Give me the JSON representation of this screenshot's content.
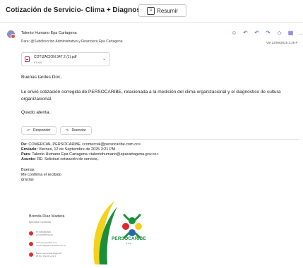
{
  "header": {
    "subject": "Cotización de Servicio- Clima + Diagnostico",
    "summarize_label": "Resumir"
  },
  "message": {
    "sender": "Talento Humano Epa Cartagena",
    "to_line": "Para: @Subdireccion Administrativa y Financiera Epa Cartagena",
    "date": "Vie 12/09/2025 3:26 P",
    "attachment": {
      "name": "COTIZACION 347 2 (1).pdf",
      "size": "97 KB"
    },
    "body": {
      "greeting": "Buenas tardes Doc,",
      "paragraph": "Le envió cotización corregida de PERSOCARIBE, relacionada a la medición del clima organizacional y el diagnostico de cultura organizacional.",
      "closing": "Quedo atenta."
    },
    "reply_label": "Responder",
    "forward_label": "Reenviar"
  },
  "quoted": {
    "from_label": "De:",
    "from_value": "COMERCIAL PERSOCARIBE <comercial@persocaribe.com.co>",
    "sent_label": "Enviado:",
    "sent_value": "Viernes, 12 de Septiembre de 2025 3:21 PM",
    "to_label": "Para:",
    "to_value": "Talento Humano Epa Cartagena <talentohumano@epacartagena.gov.co>",
    "subject_label": "Asunto:",
    "subject_value": "RE: Solicitud cotización de servicio,.",
    "lines": [
      "Buenas",
      "Me confirma el recibido",
      "gracias"
    ]
  },
  "signature": {
    "name": "Brenda Diaz Madera",
    "role": "Ejecutiva Comercial",
    "phone": "57 6056836665 +57301559T1235",
    "web": "www.persocaribe.com comercial@persocaribe.com.co",
    "address": "Barrio Serrezuela Diagonal 28 No. 32a14 Local 1",
    "brand": "PERSOCARIBE",
    "brand_sub": "S.A.S"
  },
  "colors": {
    "accent": "#5b5fc7",
    "brand_green": "#1a8f3a",
    "brand_yellow": "#f2d21b",
    "signature_red": "#e02a2a"
  }
}
